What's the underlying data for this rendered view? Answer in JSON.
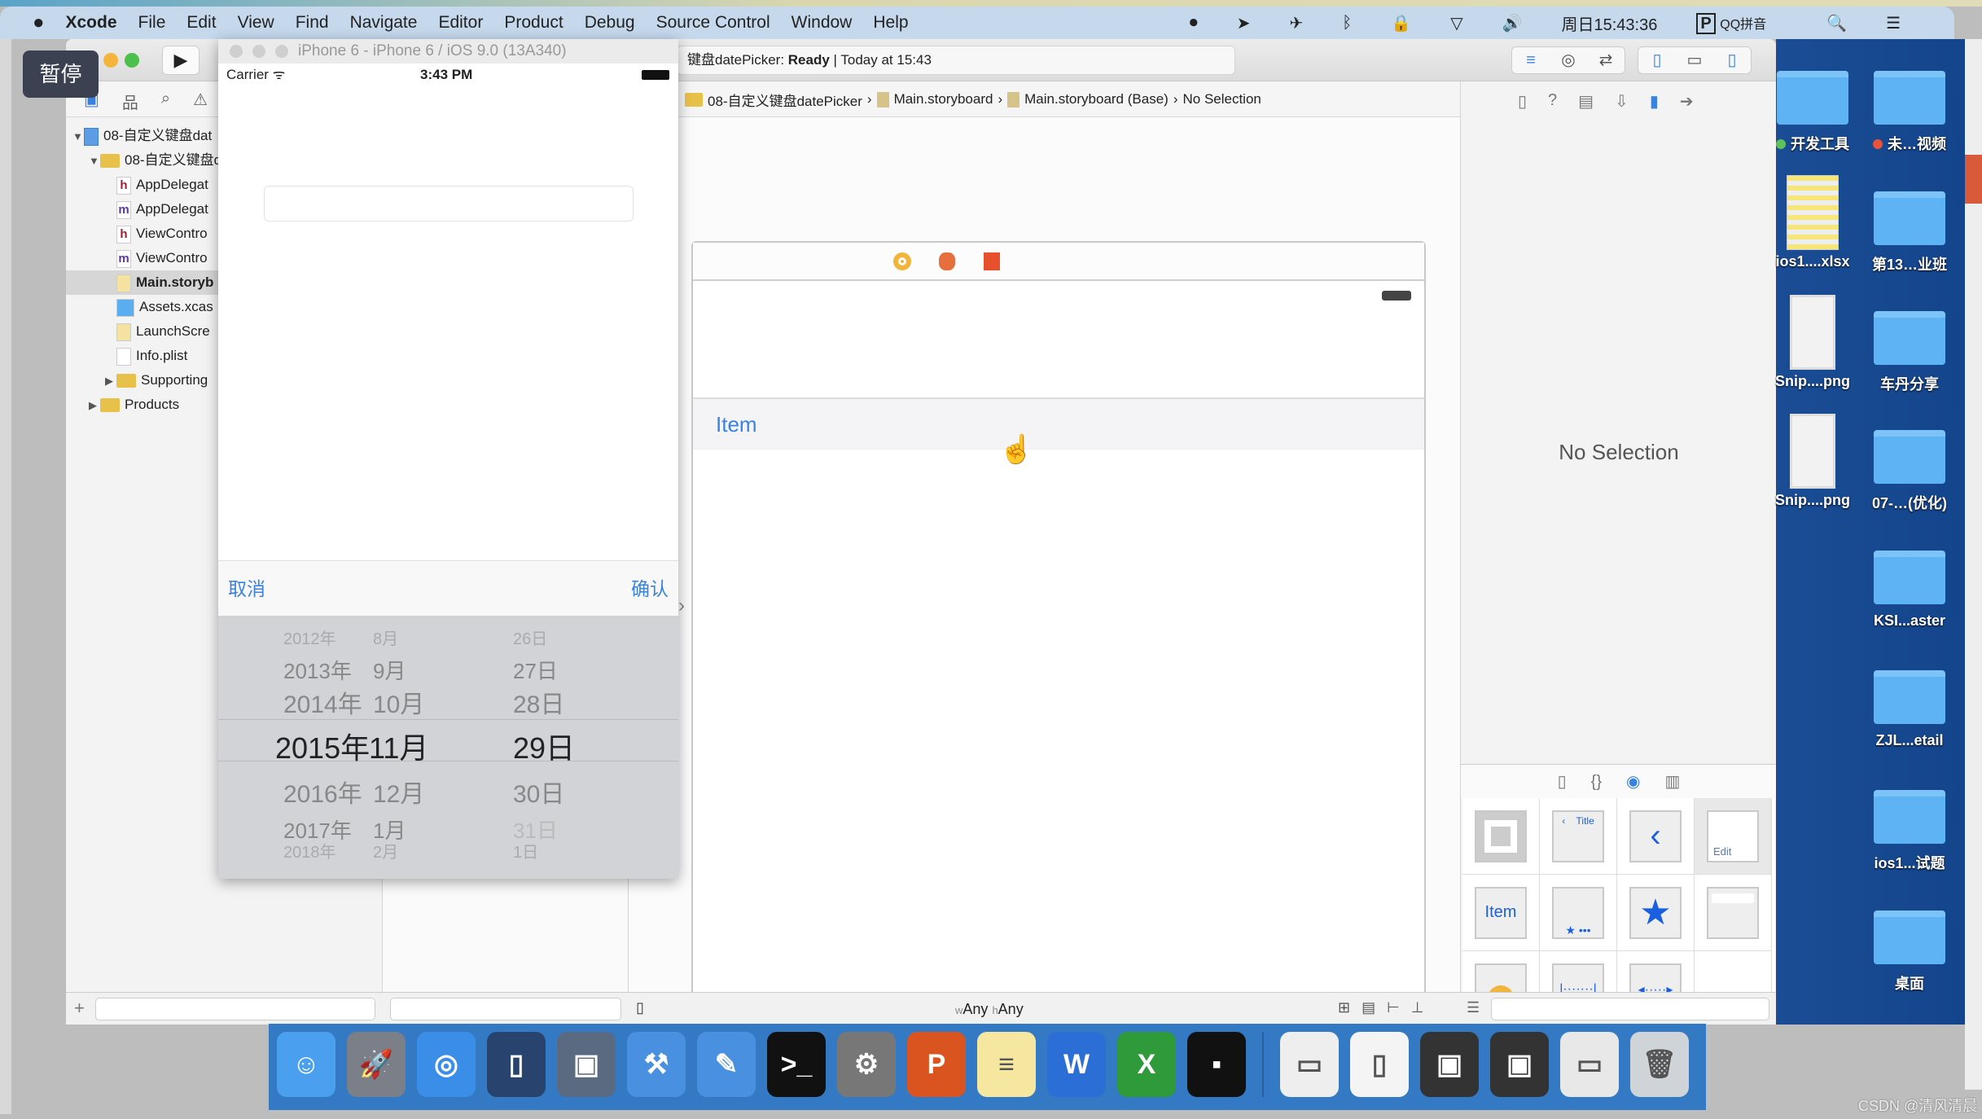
{
  "menubar": {
    "apple": "",
    "items": [
      "Xcode",
      "File",
      "Edit",
      "View",
      "Find",
      "Navigate",
      "Editor",
      "Product",
      "Debug",
      "Source Control",
      "Window",
      "Help"
    ],
    "clock": "周日15:43:36",
    "input_method": "QQ拼音"
  },
  "overlay": {
    "pause_label": "暂停"
  },
  "toolbar": {
    "activity_project": "键盘datePicker:",
    "activity_status": "Ready",
    "activity_time": "Today at 15:43"
  },
  "breadcrumb": [
    "08-自定义键盘datePicker",
    "Main.storyboard",
    "Main.storyboard (Base)",
    "No Selection"
  ],
  "navigator": {
    "items": [
      {
        "label": "08-自定义键盘dat",
        "icon": "project-icon",
        "level": 0,
        "disclosure": "open"
      },
      {
        "label": "08-自定义键盘d",
        "icon": "folder-icon",
        "level": 1,
        "disclosure": "open"
      },
      {
        "label": "AppDelegat",
        "icon": "h",
        "level": 2
      },
      {
        "label": "AppDelegat",
        "icon": "m",
        "level": 2
      },
      {
        "label": "ViewContro",
        "icon": "h",
        "level": 2
      },
      {
        "label": "ViewContro",
        "icon": "m",
        "level": 2
      },
      {
        "label": "Main.storyb",
        "icon": "storyboard",
        "level": 2,
        "selected": true
      },
      {
        "label": "Assets.xcas",
        "icon": "assets",
        "level": 2
      },
      {
        "label": "LaunchScre",
        "icon": "storyboard",
        "level": 2
      },
      {
        "label": "Info.plist",
        "icon": "plist",
        "level": 2
      },
      {
        "label": "Supporting",
        "icon": "folder-icon",
        "level": 2,
        "disclosure": "closed"
      },
      {
        "label": "Products",
        "icon": "folder-icon",
        "level": 1,
        "disclosure": "closed"
      }
    ]
  },
  "simulator": {
    "title": "iPhone 6 - iPhone 6 / iOS 9.0 (13A340)",
    "carrier": "Carrier",
    "time": "3:43 PM",
    "cancel": "取消",
    "confirm": "确认",
    "picker": {
      "years": [
        "2012年",
        "2013年",
        "2014年",
        "2015年",
        "2016年",
        "2017年",
        "2018年"
      ],
      "months": [
        "8月",
        "9月",
        "10月",
        "11月",
        "12月",
        "1月",
        "2月"
      ],
      "days": [
        "26日",
        "27日",
        "28日",
        "29日",
        "30日",
        "31日",
        "1日"
      ],
      "selected": {
        "year": "2015年",
        "month": "11月",
        "day": "29日"
      }
    }
  },
  "canvas": {
    "bar_item": "Item",
    "size_class_w": "w",
    "size_class_w_value": "Any",
    "size_class_h": "h",
    "size_class_h_value": "Any"
  },
  "inspector": {
    "empty_label": "No Selection"
  },
  "library": {
    "items": [
      {
        "name": "view-controller"
      },
      {
        "name": "navigation-bar",
        "title": "Title"
      },
      {
        "name": "navigation-item"
      },
      {
        "name": "toolbar",
        "label": "Edit"
      },
      {
        "name": "bar-button-item",
        "label": "Item"
      },
      {
        "name": "tab-bar"
      },
      {
        "name": "tab-bar-item"
      },
      {
        "name": "search-bar"
      },
      {
        "name": "search-bar-display-controller"
      },
      {
        "name": "fixed-space"
      },
      {
        "name": "flexible-space"
      }
    ]
  },
  "desktop": {
    "left": [
      {
        "label": "开发工具",
        "type": "folder",
        "tag": "#5cc35a"
      },
      {
        "label": "ios1....xlsx",
        "type": "xlsx"
      },
      {
        "label": "Snip....png",
        "type": "png"
      },
      {
        "label": "Snip....png",
        "type": "png"
      }
    ],
    "right": [
      {
        "label": "未…视频",
        "type": "folder",
        "tag": "#e8533a"
      },
      {
        "label": "第13…业班",
        "type": "folder"
      },
      {
        "label": "车丹分享",
        "type": "folder"
      },
      {
        "label": "07-…(优化)",
        "type": "folder"
      },
      {
        "label": "KSI...aster",
        "type": "folder"
      },
      {
        "label": "ZJL...etail",
        "type": "folder"
      },
      {
        "label": "ios1...试题",
        "type": "folder"
      },
      {
        "label": "桌面",
        "type": "folder"
      }
    ]
  },
  "dock": [
    {
      "name": "finder",
      "color": "#4aa0ee",
      "glyph": "☺"
    },
    {
      "name": "launchpad",
      "color": "#7a7f88",
      "glyph": "🚀"
    },
    {
      "name": "safari",
      "color": "#3b8ee8",
      "glyph": "◎"
    },
    {
      "name": "mouse-app",
      "color": "#27436e",
      "glyph": "▯"
    },
    {
      "name": "media-app",
      "color": "#5a6a80",
      "glyph": "▣"
    },
    {
      "name": "xcode",
      "color": "#4a90e0",
      "glyph": "⚒"
    },
    {
      "name": "instruments",
      "color": "#4a90e0",
      "glyph": "✎"
    },
    {
      "name": "terminal",
      "color": "#111",
      "glyph": ">_"
    },
    {
      "name": "system-preferences",
      "color": "#777",
      "glyph": "⚙"
    },
    {
      "name": "powerpoint",
      "color": "#d9541e",
      "glyph": "P"
    },
    {
      "name": "notes",
      "color": "#f6e7a0",
      "glyph": "≡"
    },
    {
      "name": "word",
      "color": "#2b6fd6",
      "glyph": "W"
    },
    {
      "name": "excel",
      "color": "#2e9a3a",
      "glyph": "X"
    },
    {
      "name": "exec",
      "color": "#111",
      "glyph": "▪"
    },
    {
      "name": "document-1",
      "color": "#eee",
      "glyph": "▭"
    },
    {
      "name": "document-2",
      "color": "#f4f4f4",
      "glyph": "▯"
    },
    {
      "name": "video-1",
      "color": "#333",
      "glyph": "▣"
    },
    {
      "name": "video-2",
      "color": "#333",
      "glyph": "▣"
    },
    {
      "name": "document-3",
      "color": "#e8e8e8",
      "glyph": "▭"
    },
    {
      "name": "trash",
      "color": "#cfd4d8",
      "glyph": "🗑"
    }
  ],
  "watermark": "CSDN @清风清晨",
  "colors": {
    "accent": "#3a82e0",
    "menubar": "#c5d8ec",
    "desktop": "#1a4d95",
    "dock": "#3479c4"
  }
}
